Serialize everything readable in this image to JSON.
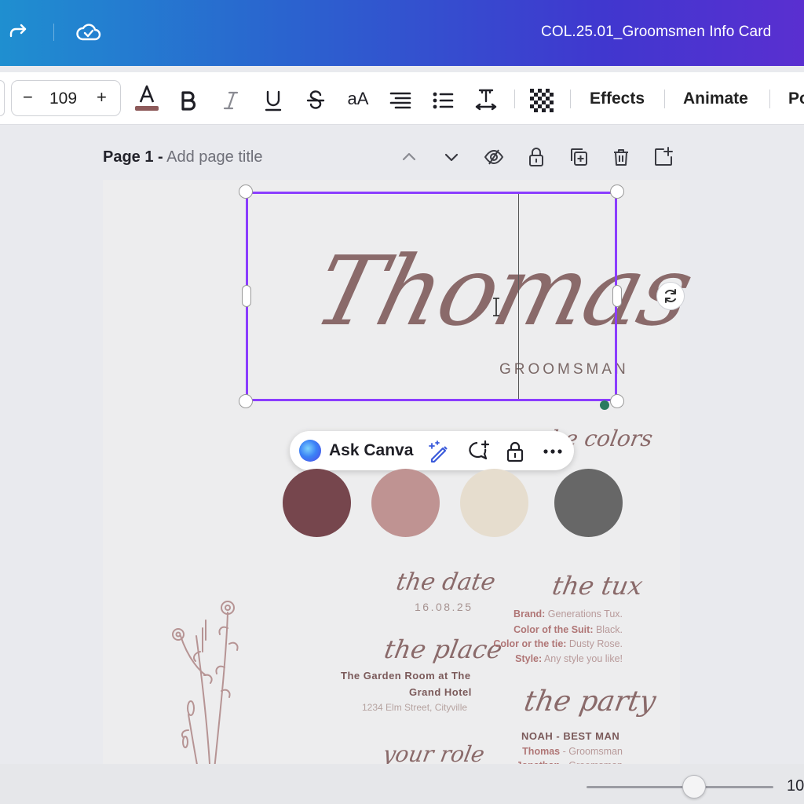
{
  "header": {
    "doc_title": "COL.25.01_Groomsmen Info Card"
  },
  "toolbar": {
    "font_size": "109",
    "minus": "−",
    "plus": "+",
    "case_label": "aA",
    "effects_label": "Effects",
    "animate_label": "Animate",
    "position_label": "Po"
  },
  "page_header": {
    "page_label": "Page 1 -",
    "title_placeholder": "Add page title"
  },
  "ask_bar": {
    "label": "Ask Canva"
  },
  "card": {
    "name": "Thomas",
    "role_title": "GROOMSMAN",
    "colors_heading": "the colors",
    "colors": [
      "#76464d",
      "#bf9392",
      "#e6ddce",
      "#676767"
    ],
    "date_heading": "the date",
    "date": "16.08.25",
    "place_heading": "the place",
    "place_name_1": "The Garden Room at The",
    "place_name_2": "Grand Hotel",
    "place_address": "1234 Elm Street, Cityville",
    "role_heading": "your role",
    "tux_heading": "the tux",
    "tux": [
      {
        "k": "Brand:",
        "v": " Generations Tux."
      },
      {
        "k": "Color of the Suit:",
        "v": " Black."
      },
      {
        "k": "Color or the tie:",
        "v": " Dusty Rose."
      },
      {
        "k": "Style:",
        "v": " Any style you like!"
      }
    ],
    "party_heading": "the party",
    "party_best_man": "NOAH - BEST MAN",
    "party_member_1_name": "Thomas",
    "party_member_1_role": " - Groomsman",
    "party_member_2_name": "Jonathan",
    "party_member_2_role": " - Groomsman"
  },
  "zoom": {
    "label": "10"
  },
  "accent": "#8b3dff"
}
